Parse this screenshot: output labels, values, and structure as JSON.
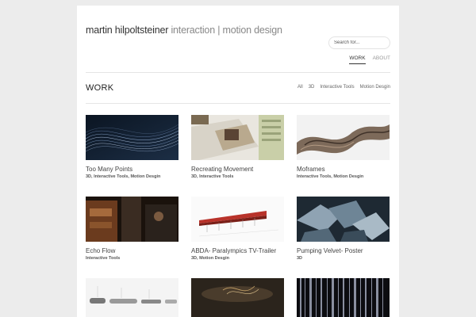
{
  "header": {
    "logo_name": "martin hilpoltsteiner",
    "logo_tagline": "interaction | motion design"
  },
  "search": {
    "placeholder": "Search for..."
  },
  "nav": {
    "work": "WORK",
    "about": "ABOUT"
  },
  "section": {
    "title": "WORK"
  },
  "filters": [
    "All",
    "3D",
    "Interactive Tools",
    "Motion Desgin"
  ],
  "projects": [
    {
      "title": "Too Many Points",
      "tags": "3D, Interactive Tools, Motion Desgin"
    },
    {
      "title": "Recreating Movement",
      "tags": "3D, Interactive Tools"
    },
    {
      "title": "Moframes",
      "tags": "Interactive Tools, Motion Desgin"
    },
    {
      "title": "Echo Flow",
      "tags": "Interactive Tools"
    },
    {
      "title": "ABDA- Paralympics TV-Trailer",
      "tags": "3D, Motion Desgin"
    },
    {
      "title": "Pumping Velvet- Poster",
      "tags": "3D"
    },
    {
      "title": "",
      "tags": ""
    },
    {
      "title": "",
      "tags": ""
    },
    {
      "title": "",
      "tags": ""
    }
  ]
}
